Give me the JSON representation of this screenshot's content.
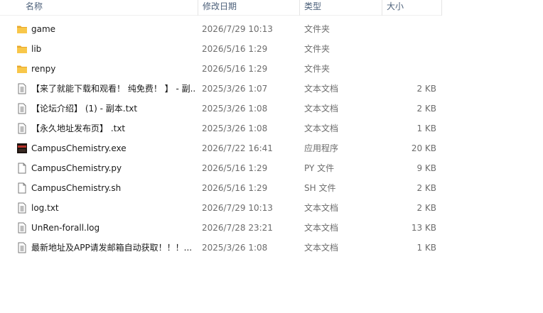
{
  "columns": {
    "name": "名称",
    "date": "修改日期",
    "type": "类型",
    "size": "大小"
  },
  "files": [
    {
      "name": "game",
      "date": "2026/7/29 10:13",
      "type": "文件夹",
      "size": "",
      "icon": "folder-icon"
    },
    {
      "name": "lib",
      "date": "2026/5/16 1:29",
      "type": "文件夹",
      "size": "",
      "icon": "folder-icon"
    },
    {
      "name": "renpy",
      "date": "2026/5/16 1:29",
      "type": "文件夹",
      "size": "",
      "icon": "folder-icon"
    },
    {
      "name": "【来了就能下载和观看！ 纯免费！ 】 - 副...",
      "date": "2025/3/26 1:07",
      "type": "文本文档",
      "size": "2 KB",
      "icon": "text-file-icon"
    },
    {
      "name": "【论坛介绍】 (1) - 副本.txt",
      "date": "2025/3/26 1:08",
      "type": "文本文档",
      "size": "2 KB",
      "icon": "text-file-icon"
    },
    {
      "name": "【永久地址发布页】 .txt",
      "date": "2025/3/26 1:08",
      "type": "文本文档",
      "size": "1 KB",
      "icon": "text-file-icon"
    },
    {
      "name": "CampusChemistry.exe",
      "date": "2026/7/22 16:41",
      "type": "应用程序",
      "size": "20 KB",
      "icon": "exe-app-icon"
    },
    {
      "name": "CampusChemistry.py",
      "date": "2026/5/16 1:29",
      "type": "PY 文件",
      "size": "9 KB",
      "icon": "blank-file-icon"
    },
    {
      "name": "CampusChemistry.sh",
      "date": "2026/5/16 1:29",
      "type": "SH 文件",
      "size": "2 KB",
      "icon": "blank-file-icon"
    },
    {
      "name": "log.txt",
      "date": "2026/7/29 10:13",
      "type": "文本文档",
      "size": "2 KB",
      "icon": "text-file-icon"
    },
    {
      "name": "UnRen-forall.log",
      "date": "2026/7/28 23:21",
      "type": "文本文档",
      "size": "13 KB",
      "icon": "text-file-icon"
    },
    {
      "name": "最新地址及APP请发邮箱自动获取！！！...",
      "date": "2025/3/26 1:08",
      "type": "文本文档",
      "size": "1 KB",
      "icon": "text-file-icon"
    }
  ],
  "colors": {
    "header_text": "#4c607a",
    "folder": "#f8c74a",
    "folder_dark": "#e8a82c",
    "meta_text": "#6d6d6d"
  }
}
